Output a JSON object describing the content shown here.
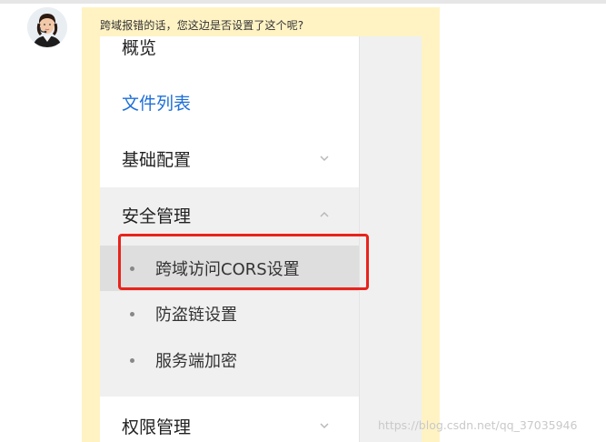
{
  "question": "跨域报错的话，您这边是否设置了这个呢?",
  "menu": {
    "overview": "概览",
    "file_list": "文件列表",
    "basic_config": "基础配置",
    "security": "安全管理",
    "security_items": [
      "跨域访问CORS设置",
      "防盗链设置",
      "服务端加密"
    ],
    "permission": "权限管理"
  },
  "watermark": "https://blog.csdn.net/qq_37035946",
  "colors": {
    "highlight": "#e8231c",
    "link": "#1e6fd9",
    "bubble": "#fff3c4"
  }
}
